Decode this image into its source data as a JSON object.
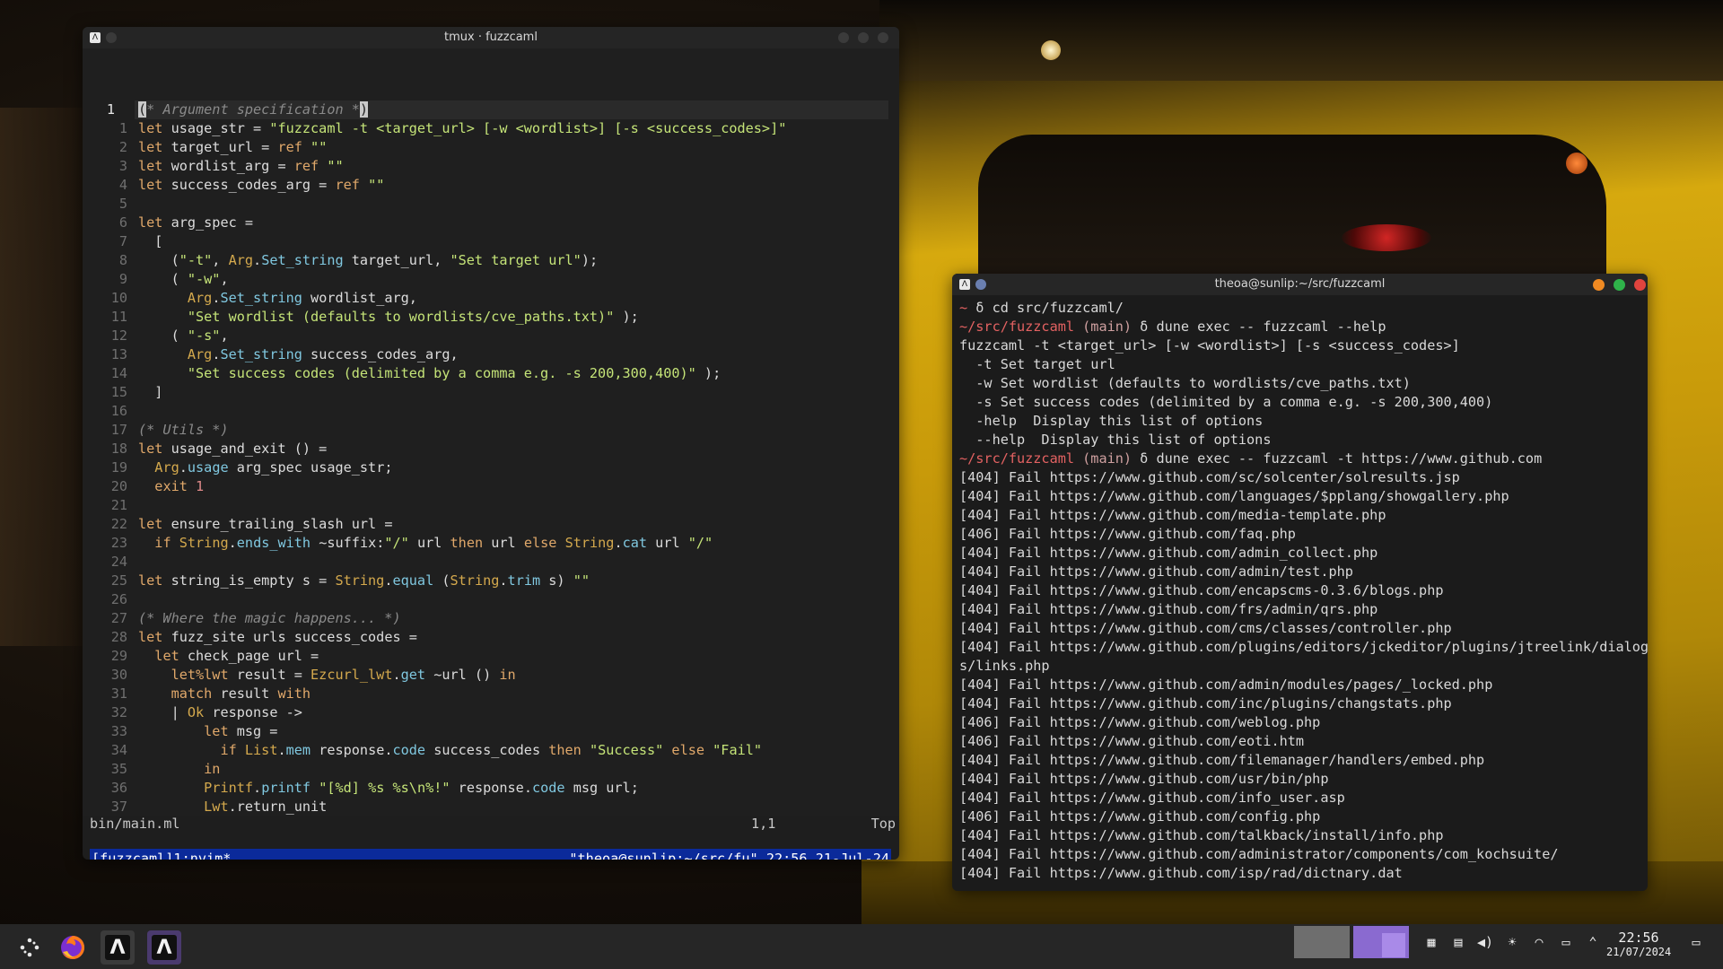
{
  "colors": {
    "tmux_status_bg": "#0b2a9a",
    "prompt_dir": "#e46262",
    "close_red": "#e0443e",
    "maximize_green": "#2fb34a",
    "minimize_orange": "#f08a22",
    "active_task_bg": "#4a3a6e"
  },
  "tmux_window": {
    "title": "tmux · fuzzcaml",
    "editor": {
      "current_line_number": "1",
      "lines": [
        {
          "n": "1",
          "text": "(* Argument specification *)"
        },
        {
          "n": "1",
          "text": "let usage_str = \"fuzzcaml -t <target_url> [-w <wordlist>] [-s <success_codes>]\""
        },
        {
          "n": "2",
          "text": "let target_url = ref \"\""
        },
        {
          "n": "3",
          "text": "let wordlist_arg = ref \"\""
        },
        {
          "n": "4",
          "text": "let success_codes_arg = ref \"\""
        },
        {
          "n": "5",
          "text": ""
        },
        {
          "n": "6",
          "text": "let arg_spec ="
        },
        {
          "n": "7",
          "text": "  ["
        },
        {
          "n": "8",
          "text": "    (\"-t\", Arg.Set_string target_url, \"Set target url\");"
        },
        {
          "n": "9",
          "text": "    ( \"-w\","
        },
        {
          "n": "10",
          "text": "      Arg.Set_string wordlist_arg,"
        },
        {
          "n": "11",
          "text": "      \"Set wordlist (defaults to wordlists/cve_paths.txt)\" );"
        },
        {
          "n": "12",
          "text": "    ( \"-s\","
        },
        {
          "n": "13",
          "text": "      Arg.Set_string success_codes_arg,"
        },
        {
          "n": "14",
          "text": "      \"Set success codes (delimited by a comma e.g. -s 200,300,400)\" );"
        },
        {
          "n": "15",
          "text": "  ]"
        },
        {
          "n": "16",
          "text": ""
        },
        {
          "n": "17",
          "text": "(* Utils *)"
        },
        {
          "n": "18",
          "text": "let usage_and_exit () ="
        },
        {
          "n": "19",
          "text": "  Arg.usage arg_spec usage_str;"
        },
        {
          "n": "20",
          "text": "  exit 1"
        },
        {
          "n": "21",
          "text": ""
        },
        {
          "n": "22",
          "text": "let ensure_trailing_slash url ="
        },
        {
          "n": "23",
          "text": "  if String.ends_with ~suffix:\"/\" url then url else String.cat url \"/\""
        },
        {
          "n": "24",
          "text": ""
        },
        {
          "n": "25",
          "text": "let string_is_empty s = String.equal (String.trim s) \"\""
        },
        {
          "n": "26",
          "text": ""
        },
        {
          "n": "27",
          "text": "(* Where the magic happens... *)"
        },
        {
          "n": "28",
          "text": "let fuzz_site urls success_codes ="
        },
        {
          "n": "29",
          "text": "  let check_page url ="
        },
        {
          "n": "30",
          "text": "    let%lwt result = Ezcurl_lwt.get ~url () in"
        },
        {
          "n": "31",
          "text": "    match result with"
        },
        {
          "n": "32",
          "text": "    | Ok response ->"
        },
        {
          "n": "33",
          "text": "        let msg ="
        },
        {
          "n": "34",
          "text": "          if List.mem response.code success_codes then \"Success\" else \"Fail\""
        },
        {
          "n": "35",
          "text": "        in"
        },
        {
          "n": "36",
          "text": "        Printf.printf \"[%d] %s %s\\n%!\" response.code msg url;"
        },
        {
          "n": "37",
          "text": "        Lwt.return_unit"
        }
      ],
      "status_file": "bin/main.ml",
      "status_pos": "1,1",
      "status_scroll": "Top"
    },
    "tmux_status": {
      "left": "[fuzzcaml]1:nvim*",
      "right": "\"theoa@sunlip:~/src/fu\" 22:56 21-Jul-24"
    }
  },
  "terminal_window": {
    "title": "theoa@sunlip:~/src/fuzzcaml",
    "lines": [
      {
        "dir": "~",
        "branch": "",
        "rest": " δ cd src/fuzzcaml/"
      },
      {
        "dir": "~/src/fuzzcaml",
        "branch": " (main)",
        "rest": " δ dune exec -- fuzzcaml --help"
      },
      {
        "dir": "",
        "branch": "",
        "rest": "fuzzcaml -t <target_url> [-w <wordlist>] [-s <success_codes>]"
      },
      {
        "dir": "",
        "branch": "",
        "rest": "  -t Set target url"
      },
      {
        "dir": "",
        "branch": "",
        "rest": "  -w Set wordlist (defaults to wordlists/cve_paths.txt)"
      },
      {
        "dir": "",
        "branch": "",
        "rest": "  -s Set success codes (delimited by a comma e.g. -s 200,300,400)"
      },
      {
        "dir": "",
        "branch": "",
        "rest": "  -help  Display this list of options"
      },
      {
        "dir": "",
        "branch": "",
        "rest": "  --help  Display this list of options"
      },
      {
        "dir": "~/src/fuzzcaml",
        "branch": " (main)",
        "rest": " δ dune exec -- fuzzcaml -t https://www.github.com"
      },
      {
        "dir": "",
        "branch": "",
        "rest": "[404] Fail https://www.github.com/sc/solcenter/solresults.jsp"
      },
      {
        "dir": "",
        "branch": "",
        "rest": "[404] Fail https://www.github.com/languages/$pplang/showgallery.php"
      },
      {
        "dir": "",
        "branch": "",
        "rest": "[404] Fail https://www.github.com/media-template.php"
      },
      {
        "dir": "",
        "branch": "",
        "rest": "[406] Fail https://www.github.com/faq.php"
      },
      {
        "dir": "",
        "branch": "",
        "rest": "[404] Fail https://www.github.com/admin_collect.php"
      },
      {
        "dir": "",
        "branch": "",
        "rest": "[404] Fail https://www.github.com/admin/test.php"
      },
      {
        "dir": "",
        "branch": "",
        "rest": "[404] Fail https://www.github.com/encapscms-0.3.6/blogs.php"
      },
      {
        "dir": "",
        "branch": "",
        "rest": "[404] Fail https://www.github.com/frs/admin/qrs.php"
      },
      {
        "dir": "",
        "branch": "",
        "rest": "[404] Fail https://www.github.com/cms/classes/controller.php"
      },
      {
        "dir": "",
        "branch": "",
        "rest": "[404] Fail https://www.github.com/plugins/editors/jckeditor/plugins/jtreelink/dialog"
      },
      {
        "dir": "",
        "branch": "",
        "rest": "s/links.php"
      },
      {
        "dir": "",
        "branch": "",
        "rest": "[404] Fail https://www.github.com/admin/modules/pages/_locked.php"
      },
      {
        "dir": "",
        "branch": "",
        "rest": "[404] Fail https://www.github.com/inc/plugins/changstats.php"
      },
      {
        "dir": "",
        "branch": "",
        "rest": "[406] Fail https://www.github.com/weblog.php"
      },
      {
        "dir": "",
        "branch": "",
        "rest": "[406] Fail https://www.github.com/eoti.htm"
      },
      {
        "dir": "",
        "branch": "",
        "rest": "[404] Fail https://www.github.com/filemanager/handlers/embed.php"
      },
      {
        "dir": "",
        "branch": "",
        "rest": "[404] Fail https://www.github.com/usr/bin/php"
      },
      {
        "dir": "",
        "branch": "",
        "rest": "[404] Fail https://www.github.com/info_user.asp"
      },
      {
        "dir": "",
        "branch": "",
        "rest": "[406] Fail https://www.github.com/config.php"
      },
      {
        "dir": "",
        "branch": "",
        "rest": "[404] Fail https://www.github.com/talkback/install/info.php"
      },
      {
        "dir": "",
        "branch": "",
        "rest": "[404] Fail https://www.github.com/administrator/components/com_kochsuite/"
      },
      {
        "dir": "",
        "branch": "",
        "rest": "[404] Fail https://www.github.com/isp/rad/dictnary.dat"
      }
    ]
  },
  "taskbar": {
    "launcher_icon": "application-launcher-icon",
    "tasks": [
      {
        "name": "firefox",
        "icon": "firefox-icon"
      },
      {
        "name": "kitty",
        "icon": "kitty-icon"
      },
      {
        "name": "kitty",
        "icon": "kitty-icon"
      }
    ],
    "tray_icons": [
      "keyboard-icon",
      "clipboard-icon",
      "volume-icon",
      "brightness-icon",
      "wifi-icon",
      "battery-icon",
      "chevron-up-icon"
    ],
    "clock_time": "22:56",
    "clock_date": "21/07/2024"
  }
}
